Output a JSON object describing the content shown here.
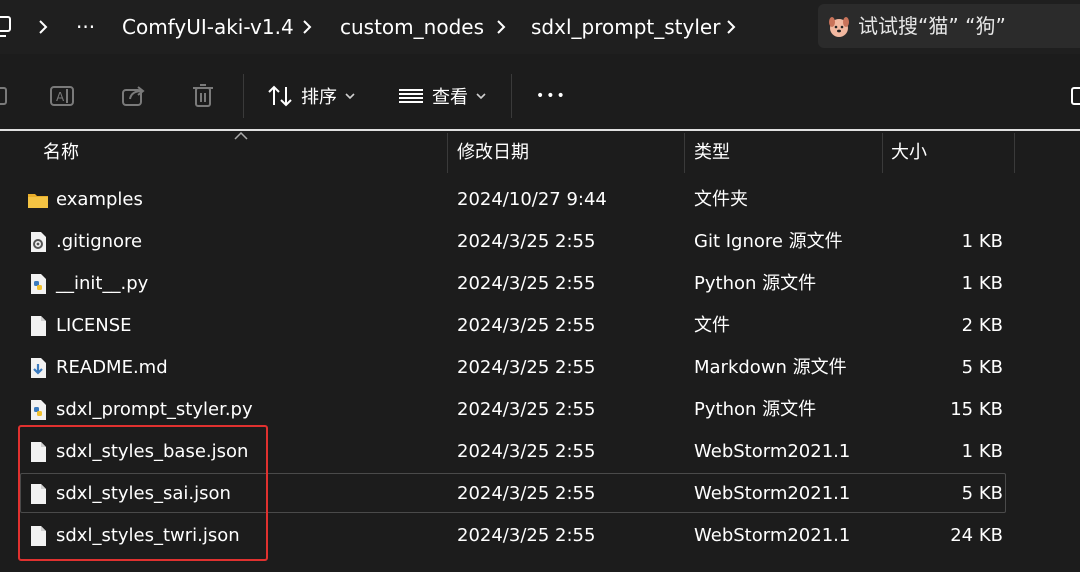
{
  "breadcrumb": {
    "ellipsis": "···",
    "items": [
      "ComfyUI-aki-v1.4",
      "custom_nodes",
      "sdxl_prompt_styler"
    ]
  },
  "search": {
    "placeholder": "试试搜“猫” “狗”"
  },
  "toolbar": {
    "sort_label": "排序",
    "view_label": "查看",
    "more_label": "•••"
  },
  "columns": {
    "name": "名称",
    "modified": "修改日期",
    "type": "类型",
    "size": "大小"
  },
  "files": [
    {
      "name": "examples",
      "modified": "2024/10/27 9:44",
      "type": "文件夹",
      "size": "",
      "icon": "folder-icon"
    },
    {
      "name": ".gitignore",
      "modified": "2024/3/25 2:55",
      "type": "Git Ignore 源文件",
      "size": "1 KB",
      "icon": "gear-file-icon"
    },
    {
      "name": "__init__.py",
      "modified": "2024/3/25 2:55",
      "type": "Python 源文件",
      "size": "1 KB",
      "icon": "python-file-icon"
    },
    {
      "name": "LICENSE",
      "modified": "2024/3/25 2:55",
      "type": "文件",
      "size": "2 KB",
      "icon": "blank-file-icon"
    },
    {
      "name": "README.md",
      "modified": "2024/3/25 2:55",
      "type": "Markdown 源文件",
      "size": "5 KB",
      "icon": "markdown-file-icon"
    },
    {
      "name": "sdxl_prompt_styler.py",
      "modified": "2024/3/25 2:55",
      "type": "Python 源文件",
      "size": "15 KB",
      "icon": "python-file-icon"
    },
    {
      "name": "sdxl_styles_base.json",
      "modified": "2024/3/25 2:55",
      "type": "WebStorm2021.1",
      "size": "1 KB",
      "icon": "blank-file-icon"
    },
    {
      "name": "sdxl_styles_sai.json",
      "modified": "2024/3/25 2:55",
      "type": "WebStorm2021.1",
      "size": "5 KB",
      "icon": "blank-file-icon"
    },
    {
      "name": "sdxl_styles_twri.json",
      "modified": "2024/3/25 2:55",
      "type": "WebStorm2021.1",
      "size": "24 KB",
      "icon": "blank-file-icon"
    }
  ],
  "colors": {
    "background": "#1c1c1c",
    "folder": "#f4c343",
    "highlight": "#e0312f",
    "python": "#3b7bbf"
  }
}
